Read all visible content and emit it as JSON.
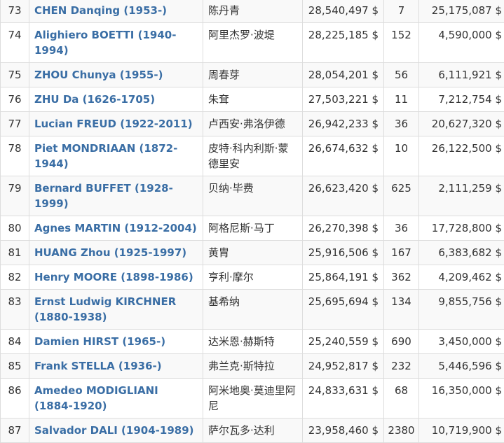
{
  "rows": [
    {
      "rank": "73",
      "name": "CHEN Danqing (1953-)",
      "cn": "陈丹青",
      "total": "28,540,497 $",
      "lots": "7",
      "max": "25,175,087 $"
    },
    {
      "rank": "74",
      "name": "Alighiero BOETTI (1940-1994)",
      "cn": "阿里杰罗·波堤",
      "total": "28,225,185 $",
      "lots": "152",
      "max": "4,590,000 $"
    },
    {
      "rank": "75",
      "name": "ZHOU Chunya (1955-)",
      "cn": "周春芽",
      "total": "28,054,201 $",
      "lots": "56",
      "max": "6,111,921 $"
    },
    {
      "rank": "76",
      "name": "ZHU Da (1626-1705)",
      "cn": "朱耷",
      "total": "27,503,221 $",
      "lots": "11",
      "max": "7,212,754 $"
    },
    {
      "rank": "77",
      "name": "Lucian FREUD (1922-2011)",
      "cn": "卢西安·弗洛伊德",
      "total": "26,942,233 $",
      "lots": "36",
      "max": "20,627,320 $"
    },
    {
      "rank": "78",
      "name": "Piet MONDRIAAN (1872-1944)",
      "cn": "皮特·科内利斯·蒙德里安",
      "total": "26,674,632 $",
      "lots": "10",
      "max": "26,122,500 $"
    },
    {
      "rank": "79",
      "name": "Bernard BUFFET (1928-1999)",
      "cn": "贝纳·毕费",
      "total": "26,623,420 $",
      "lots": "625",
      "max": "2,111,259 $"
    },
    {
      "rank": "80",
      "name": "Agnes MARTIN (1912-2004)",
      "cn": "阿格尼斯·马丁",
      "total": "26,270,398 $",
      "lots": "36",
      "max": "17,728,800 $"
    },
    {
      "rank": "81",
      "name": "HUANG Zhou (1925-1997)",
      "cn": "黄胄",
      "total": "25,916,506 $",
      "lots": "167",
      "max": "6,383,682 $"
    },
    {
      "rank": "82",
      "name": "Henry MOORE (1898-1986)",
      "cn": "亨利·摩尔",
      "total": "25,864,191 $",
      "lots": "362",
      "max": "4,209,462 $"
    },
    {
      "rank": "83",
      "name": "Ernst Ludwig KIRCHNER (1880-1938)",
      "cn": "基希纳",
      "total": "25,695,694 $",
      "lots": "134",
      "max": "9,855,756 $"
    },
    {
      "rank": "84",
      "name": "Damien HIRST (1965-)",
      "cn": "达米恩·赫斯特",
      "total": "25,240,559 $",
      "lots": "690",
      "max": "3,450,000 $"
    },
    {
      "rank": "85",
      "name": "Frank STELLA (1936-)",
      "cn": "弗兰克·斯特拉",
      "total": "24,952,817 $",
      "lots": "232",
      "max": "5,446,596 $"
    },
    {
      "rank": "86",
      "name": "Amedeo MODIGLIANI (1884-1920)",
      "cn": "阿米地奥·莫迪里阿尼",
      "total": "24,833,631 $",
      "lots": "68",
      "max": "16,350,000 $"
    },
    {
      "rank": "87",
      "name": "Salvador DALI (1904-1989)",
      "cn": "萨尔瓦多·达利",
      "total": "23,958,460 $",
      "lots": "2380",
      "max": "10,719,900 $"
    }
  ],
  "colors": {
    "link": "#3a6ea5",
    "text": "#333333",
    "border": "#dddddd",
    "stripe": "#f9f9f9"
  }
}
